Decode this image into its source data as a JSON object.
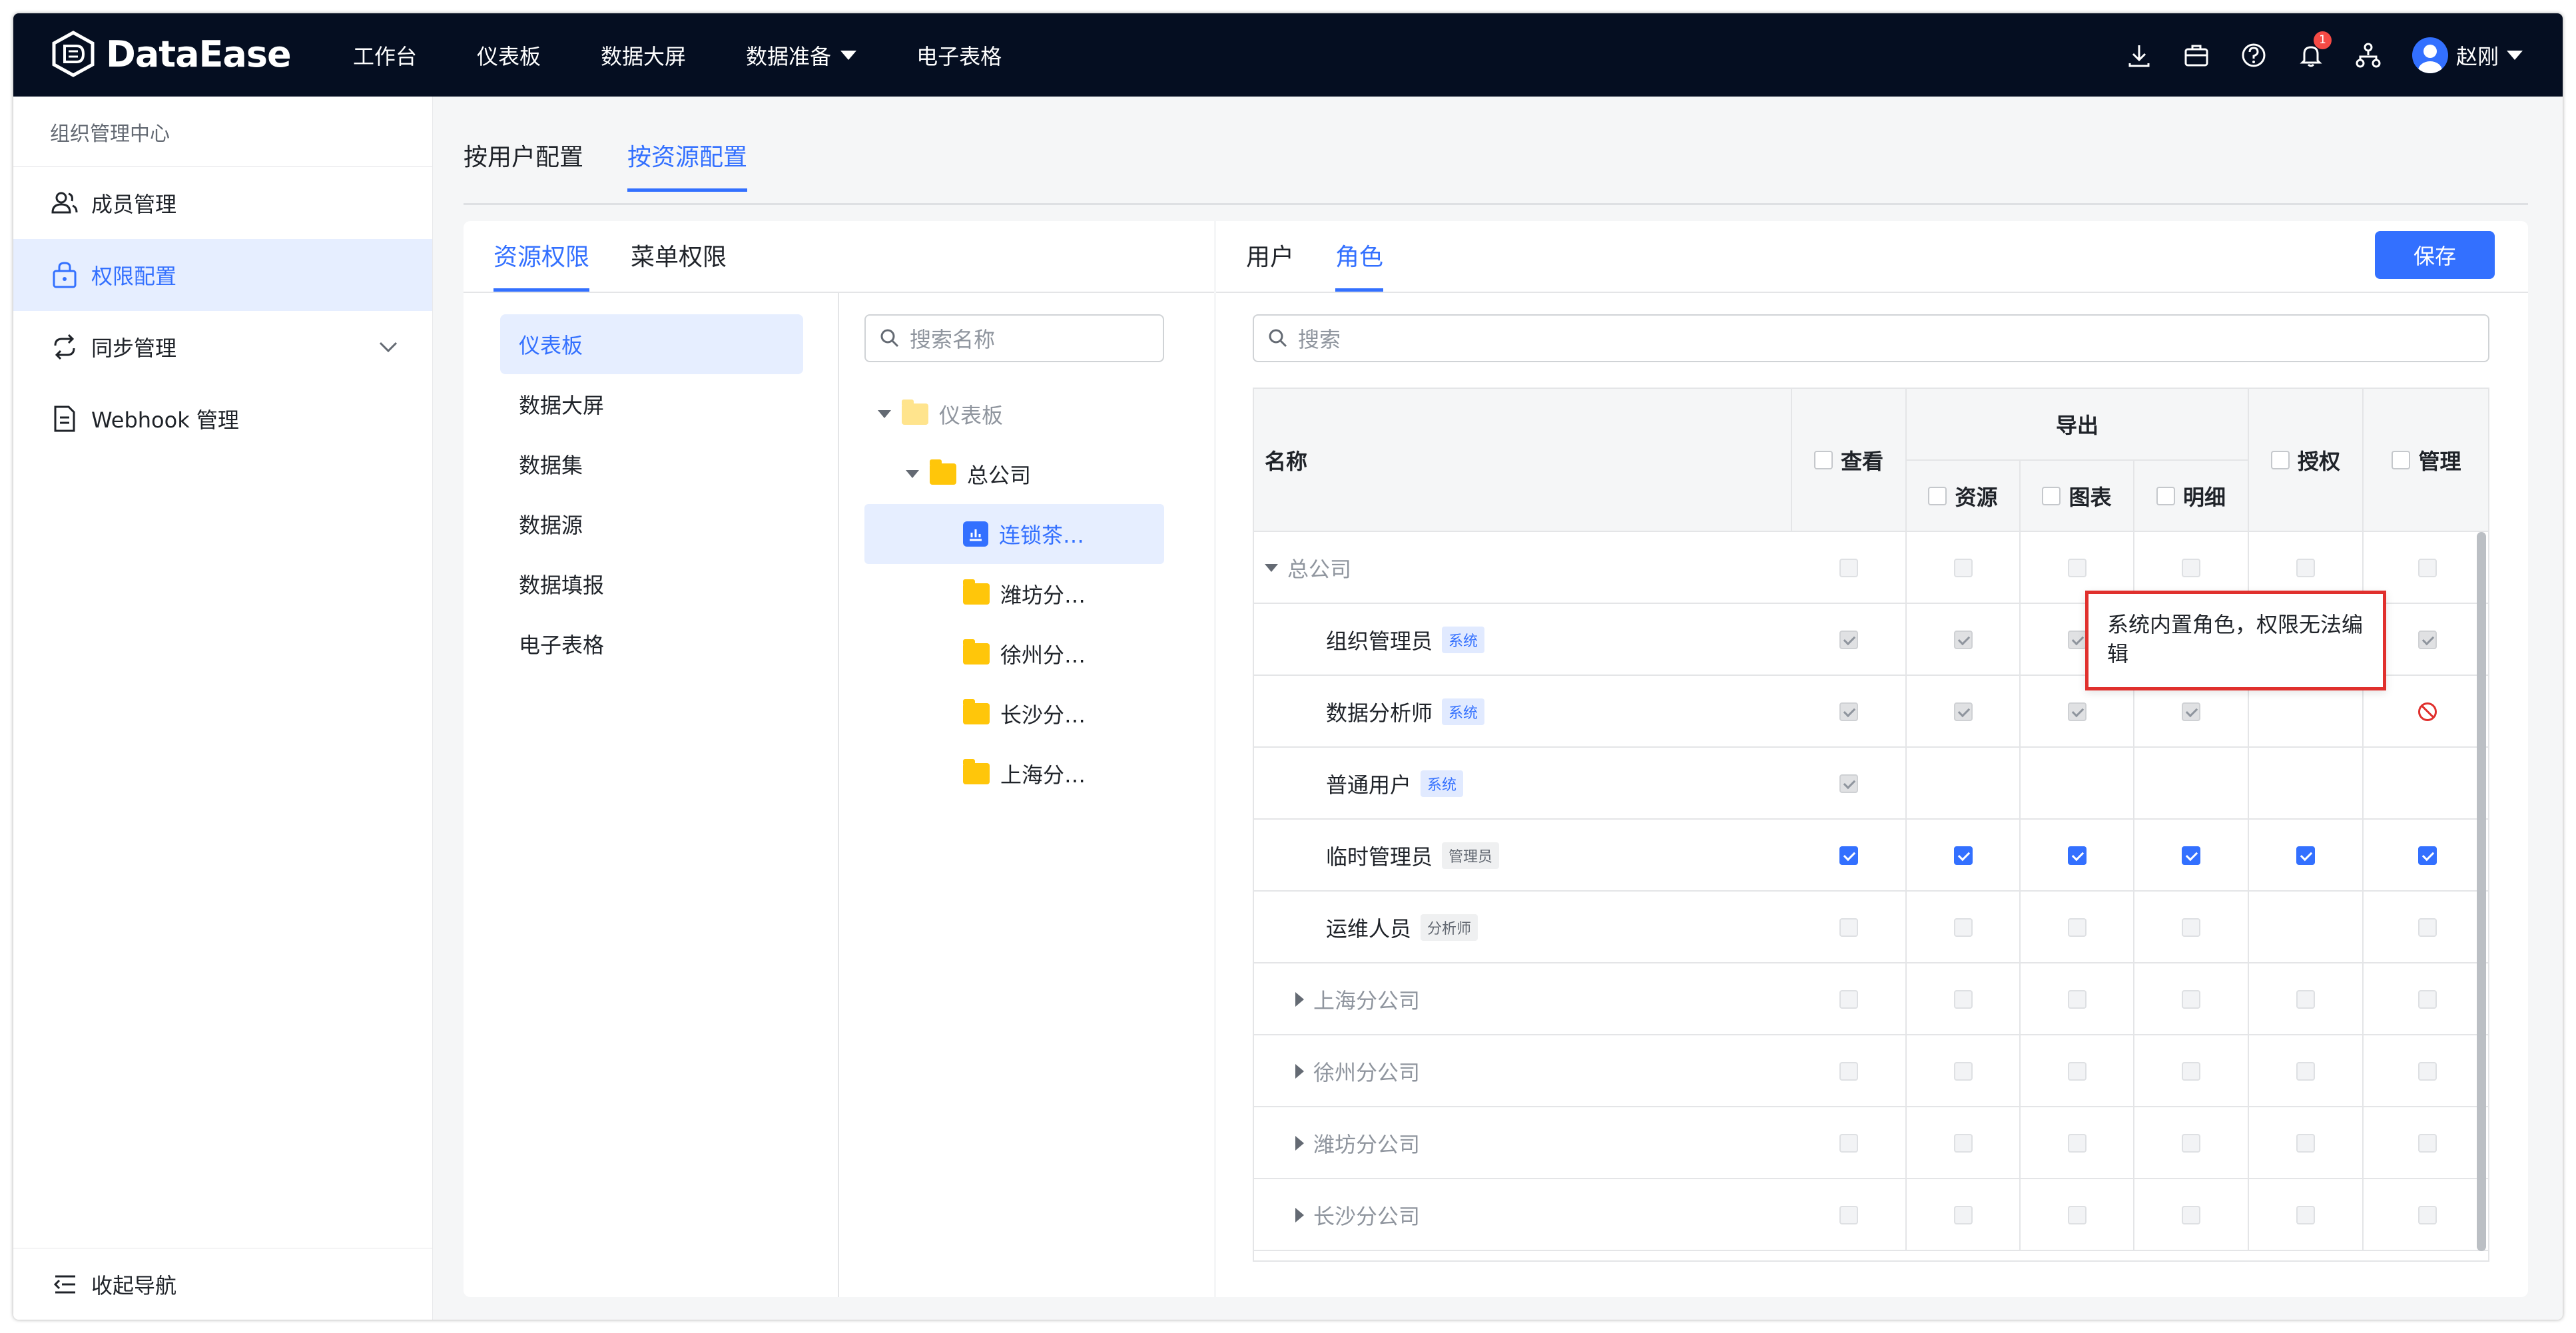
{
  "app": {
    "name": "DataEase"
  },
  "nav": {
    "items": [
      "工作台",
      "仪表板",
      "数据大屏",
      "数据准备",
      "电子表格"
    ]
  },
  "header": {
    "notification_count": "1",
    "user_name": "赵刚"
  },
  "sidebar": {
    "title": "组织管理中心",
    "items": [
      "成员管理",
      "权限配置",
      "同步管理",
      "Webhook 管理"
    ],
    "collapse_label": "收起导航"
  },
  "config_tabs": [
    "按用户配置",
    "按资源配置"
  ],
  "left_panel": {
    "tabs": [
      "资源权限",
      "菜单权限"
    ],
    "resources": [
      "仪表板",
      "数据大屏",
      "数据集",
      "数据源",
      "数据填报",
      "电子表格"
    ],
    "search_placeholder": "搜索名称",
    "tree": [
      {
        "label": "仪表板",
        "level": 0
      },
      {
        "label": "总公司",
        "level": 1
      },
      {
        "label": "连锁茶…",
        "level": 2
      },
      {
        "label": "潍坊分…",
        "level": 2
      },
      {
        "label": "徐州分…",
        "level": 2
      },
      {
        "label": "长沙分…",
        "level": 2
      },
      {
        "label": "上海分…",
        "level": 2
      }
    ]
  },
  "right_panel": {
    "tabs": [
      "用户",
      "角色"
    ],
    "save_label": "保存",
    "search_placeholder": "搜索",
    "columns": {
      "name": "名称",
      "view": "查看",
      "export": "导出",
      "export_sub": [
        "资源",
        "图表",
        "明细"
      ],
      "auth": "授权",
      "manage": "管理"
    },
    "rows": [
      {
        "name": "总公司",
        "tag": "",
        "group": true
      },
      {
        "name": "组织管理员",
        "tag": "系统"
      },
      {
        "name": "数据分析师",
        "tag": "系统"
      },
      {
        "name": "普通用户",
        "tag": "系统"
      },
      {
        "name": "临时管理员",
        "tag": "管理员"
      },
      {
        "name": "运维人员",
        "tag": "分析师"
      },
      {
        "name": "上海分公司",
        "tag": "",
        "group": true
      },
      {
        "name": "徐州分公司",
        "tag": "",
        "group": true
      },
      {
        "name": "潍坊分公司",
        "tag": "",
        "group": true
      },
      {
        "name": "长沙分公司",
        "tag": "",
        "group": true
      }
    ],
    "tooltip": "系统内置角色，权限无法编辑"
  },
  "colors": {
    "accent": "#3370ff",
    "topbar": "#050e21",
    "tooltip_border": "#e0302d"
  }
}
